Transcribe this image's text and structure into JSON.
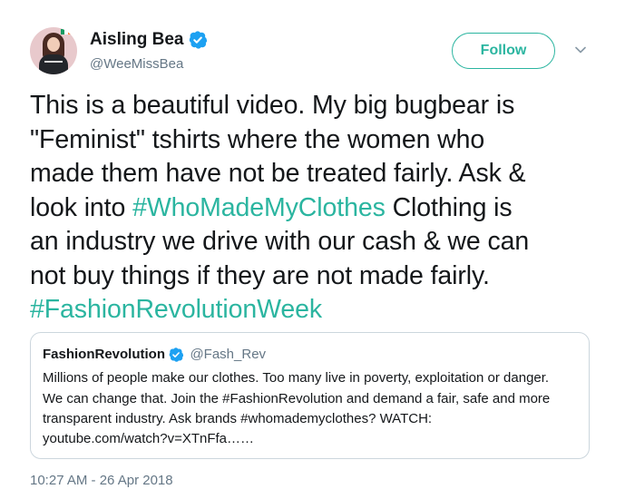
{
  "author": {
    "display_name": "Aisling Bea",
    "handle": "@WeeMissBea",
    "verified_icon": "verified-badge-icon"
  },
  "follow_button": {
    "label": "Follow"
  },
  "menu": {
    "icon": "chevron-down-icon"
  },
  "tweet": {
    "lines": [
      [
        {
          "text": "This is a beautiful video. My big bugbear is",
          "hashtag": false
        }
      ],
      [
        {
          "text": "\"Feminist\" tshirts where the women who",
          "hashtag": false
        }
      ],
      [
        {
          "text": "made them have not be treated fairly. Ask &",
          "hashtag": false
        }
      ],
      [
        {
          "text": "look into ",
          "hashtag": false
        },
        {
          "text": "#WhoMadeMyClothes",
          "hashtag": true
        },
        {
          "text": " Clothing is",
          "hashtag": false
        }
      ],
      [
        {
          "text": "an industry we drive with our cash & we can",
          "hashtag": false
        }
      ],
      [
        {
          "text": "not buy things if they are not made fairly.",
          "hashtag": false
        }
      ],
      [
        {
          "text": "#FashionRevolutionWeek",
          "hashtag": true
        }
      ]
    ]
  },
  "quoted_tweet": {
    "display_name": "FashionRevolution",
    "handle": "@Fash_Rev",
    "lines": [
      "Millions of people make our clothes. Too many live in poverty, exploitation or danger.",
      "We can change that. Join the #FashionRevolution and demand a fair, safe and more",
      "transparent industry. Ask brands #whomademyclothes? WATCH:",
      "youtube.com/watch?v=XTnFfa……"
    ]
  },
  "timestamp": "10:27 AM - 26 Apr 2018",
  "colors": {
    "accent": "#2bb5a0",
    "verified": "#1da1f2",
    "secondary_text": "#657786",
    "border": "#ccd6dd"
  }
}
